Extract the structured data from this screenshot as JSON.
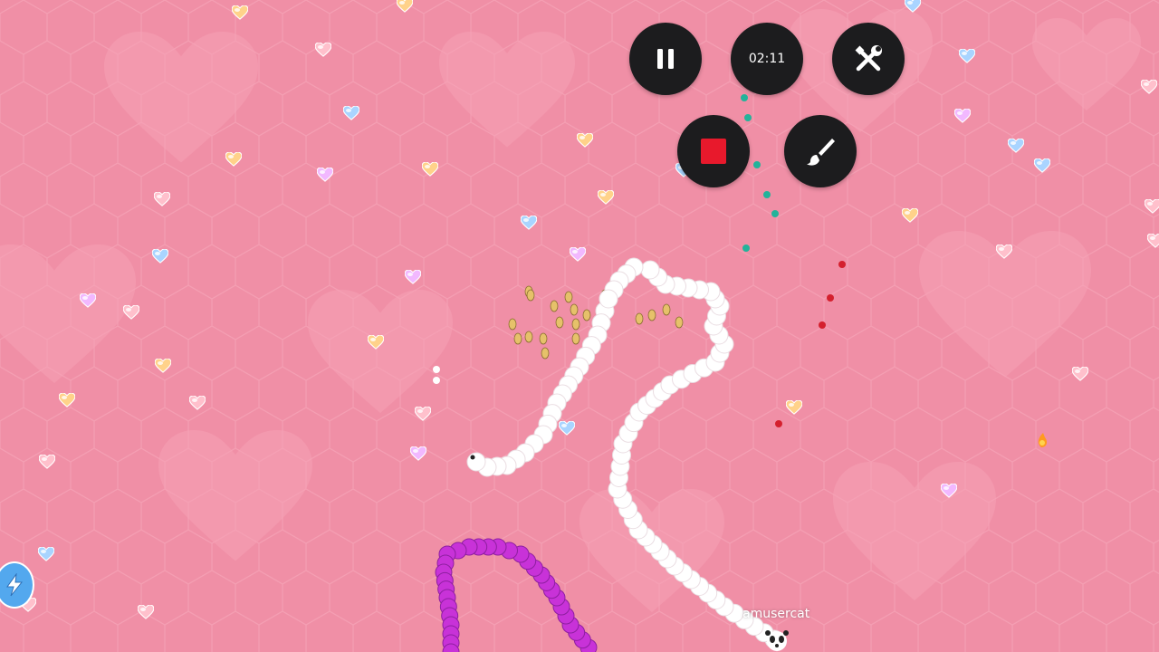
{
  "recorder": {
    "timer": "02:11",
    "pause_icon": "pause-icon",
    "tools_icon": "tools-icon",
    "stop_icon": "stop-icon",
    "brush_icon": "brush-icon"
  },
  "player": {
    "name": "amusercat"
  },
  "hud": {
    "boost_icon": "lightning-icon"
  },
  "colors": {
    "background": "#f08fa6",
    "player_snake": "#ffffff",
    "enemy_snake": "#c832d8",
    "stop_red": "#e8192c",
    "button_bg": "#1c1c1e"
  }
}
